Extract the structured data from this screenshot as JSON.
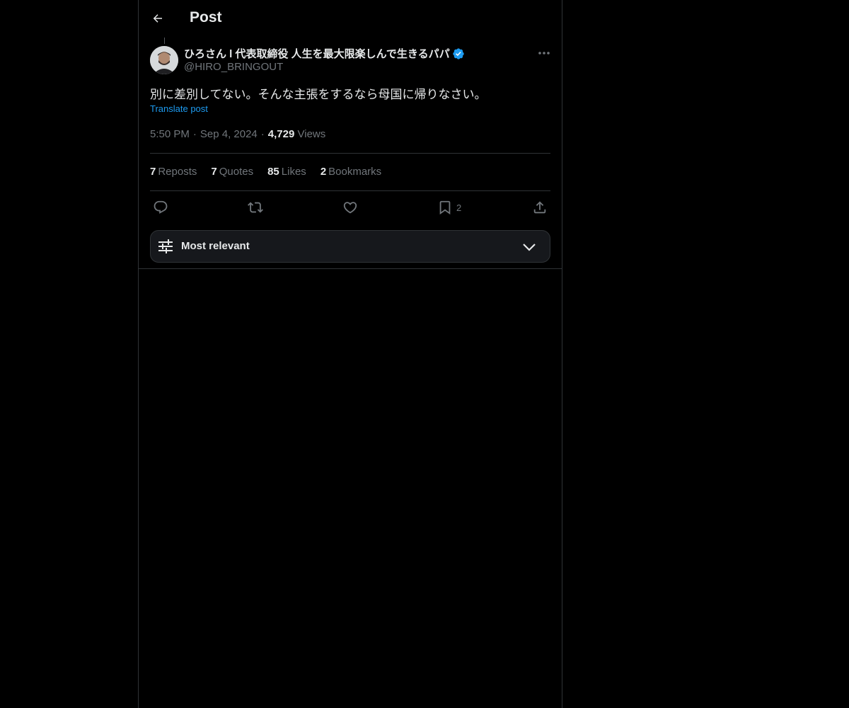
{
  "header": {
    "title": "Post",
    "back_icon": "arrow-left-icon"
  },
  "author": {
    "name": "ひろさん l 代表取締役 人生を最大限楽しんで生きるパパ",
    "handle": "@HIRO_BRINGOUT",
    "verified": true,
    "verified_color": "#1d9bf0"
  },
  "post": {
    "text": "別に差別してない。そんな主張をするなら母国に帰りなさい。",
    "translate_label": "Translate post",
    "time": "5:50 PM",
    "date": "Sep 4, 2024",
    "views_count": "4,729",
    "views_label": "Views"
  },
  "stats": {
    "reposts_count": "7",
    "reposts_label": "Reposts",
    "quotes_count": "7",
    "quotes_label": "Quotes",
    "likes_count": "85",
    "likes_label": "Likes",
    "bookmarks_count": "2",
    "bookmarks_label": "Bookmarks"
  },
  "actions": {
    "reply_icon": "reply-icon",
    "repost_icon": "repost-icon",
    "like_icon": "heart-icon",
    "bookmark_icon": "bookmark-icon",
    "bookmark_count": "2",
    "share_icon": "share-icon"
  },
  "sort": {
    "label": "Most relevant",
    "icon": "sliders-icon",
    "chevron": "chevron-down-icon"
  },
  "colors": {
    "background": "#000000",
    "text": "#e7e9ea",
    "secondary": "#71767b",
    "link": "#1d9bf0",
    "border": "#2f3336"
  }
}
